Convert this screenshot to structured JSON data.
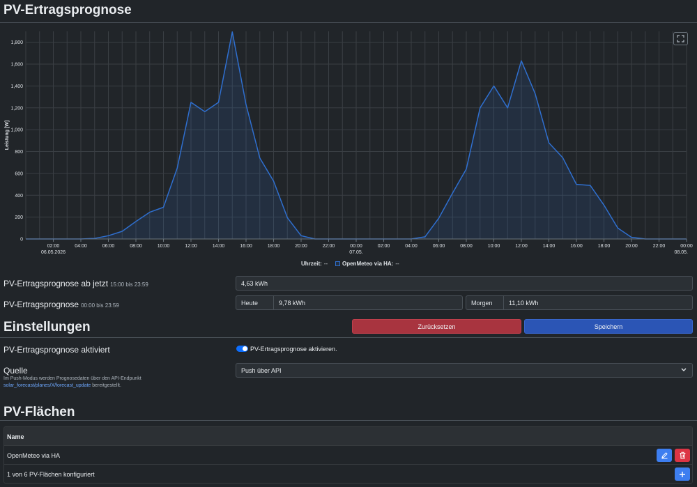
{
  "page_title": "PV-Ertragsprognose",
  "chart_data": {
    "type": "area",
    "ylabel": "Leistung [W]",
    "ylim": [
      0,
      1900
    ],
    "yticks": [
      "0",
      "200",
      "400",
      "600",
      "800",
      "1,000",
      "1,200",
      "1,400",
      "1,600",
      "1,800"
    ],
    "xticks": [
      {
        "t": 2,
        "l1": "02:00",
        "l2": "06.05.2026"
      },
      {
        "t": 4,
        "l1": "04:00",
        "l2": ""
      },
      {
        "t": 6,
        "l1": "06:00",
        "l2": ""
      },
      {
        "t": 8,
        "l1": "08:00",
        "l2": ""
      },
      {
        "t": 10,
        "l1": "10:00",
        "l2": ""
      },
      {
        "t": 12,
        "l1": "12:00",
        "l2": ""
      },
      {
        "t": 14,
        "l1": "14:00",
        "l2": ""
      },
      {
        "t": 16,
        "l1": "16:00",
        "l2": ""
      },
      {
        "t": 18,
        "l1": "18:00",
        "l2": ""
      },
      {
        "t": 20,
        "l1": "20:00",
        "l2": ""
      },
      {
        "t": 22,
        "l1": "22:00",
        "l2": ""
      },
      {
        "t": 24,
        "l1": "00:00",
        "l2": "07.05."
      },
      {
        "t": 26,
        "l1": "02:00",
        "l2": ""
      },
      {
        "t": 28,
        "l1": "04:00",
        "l2": ""
      },
      {
        "t": 30,
        "l1": "06:00",
        "l2": ""
      },
      {
        "t": 32,
        "l1": "08:00",
        "l2": ""
      },
      {
        "t": 34,
        "l1": "10:00",
        "l2": ""
      },
      {
        "t": 36,
        "l1": "12:00",
        "l2": ""
      },
      {
        "t": 38,
        "l1": "14:00",
        "l2": ""
      },
      {
        "t": 40,
        "l1": "16:00",
        "l2": ""
      },
      {
        "t": 42,
        "l1": "18:00",
        "l2": ""
      },
      {
        "t": 44,
        "l1": "20:00",
        "l2": ""
      },
      {
        "t": 46,
        "l1": "22:00",
        "l2": ""
      },
      {
        "t": 48,
        "l1": "00:00",
        "l2": "08.05."
      }
    ],
    "series": [
      {
        "name": "OpenMeteo via HA",
        "color": "#2f6fcf",
        "points": [
          [
            0,
            0
          ],
          [
            1,
            0
          ],
          [
            2,
            0
          ],
          [
            3,
            0
          ],
          [
            4,
            0
          ],
          [
            5,
            5
          ],
          [
            6,
            30
          ],
          [
            7,
            70
          ],
          [
            8,
            160
          ],
          [
            9,
            245
          ],
          [
            10,
            290
          ],
          [
            11,
            650
          ],
          [
            12,
            1250
          ],
          [
            13,
            1165
          ],
          [
            14,
            1250
          ],
          [
            15,
            1895
          ],
          [
            16,
            1230
          ],
          [
            17,
            740
          ],
          [
            18,
            530
          ],
          [
            19,
            195
          ],
          [
            20,
            30
          ],
          [
            21,
            0
          ],
          [
            22,
            0
          ],
          [
            23,
            0
          ],
          [
            24,
            0
          ],
          [
            25,
            0
          ],
          [
            26,
            0
          ],
          [
            27,
            0
          ],
          [
            28,
            0
          ],
          [
            29,
            20
          ],
          [
            30,
            190
          ],
          [
            31,
            420
          ],
          [
            32,
            640
          ],
          [
            33,
            1200
          ],
          [
            34,
            1400
          ],
          [
            35,
            1200
          ],
          [
            36,
            1630
          ],
          [
            37,
            1330
          ],
          [
            38,
            880
          ],
          [
            39,
            745
          ],
          [
            40,
            500
          ],
          [
            41,
            490
          ],
          [
            42,
            310
          ],
          [
            43,
            100
          ],
          [
            44,
            15
          ],
          [
            45,
            0
          ],
          [
            46,
            0
          ],
          [
            47,
            0
          ],
          [
            48,
            0
          ]
        ]
      }
    ],
    "legend": {
      "label_time": "Uhrzeit:",
      "time_value": "--",
      "series_label": "OpenMeteo via HA:",
      "series_value": "--"
    }
  },
  "forecast_now": {
    "label": "PV-Ertragsprognose ab jetzt",
    "range": "15:00 bis 23:59",
    "value": "4,63 kWh"
  },
  "forecast_days": {
    "label": "PV-Ertragsprognose",
    "range": "00:00 bis 23:59",
    "today_label": "Heute",
    "today_value": "9,78 kWh",
    "tomorrow_label": "Morgen",
    "tomorrow_value": "11,10 kWh"
  },
  "settings": {
    "title": "Einstellungen",
    "reset_label": "Zurücksetzen",
    "save_label": "Speichern",
    "enabled_label": "PV-Ertragsprognose aktiviert",
    "enabled_toggle_label": "PV-Ertragsprognose aktivieren.",
    "source_label": "Quelle",
    "source_help_1": "Im Push-Modus werden Prognosedaten über den API-Endpunkt",
    "source_help_link": "solar_forecast/planes/X/forecast_update",
    "source_help_2": "bereitgestellt.",
    "source_value": "Push über API"
  },
  "planes": {
    "title": "PV-Flächen",
    "col_name": "Name",
    "rows": [
      {
        "name": "OpenMeteo via HA"
      }
    ],
    "summary": "1 von 6 PV-Flächen konfiguriert"
  }
}
